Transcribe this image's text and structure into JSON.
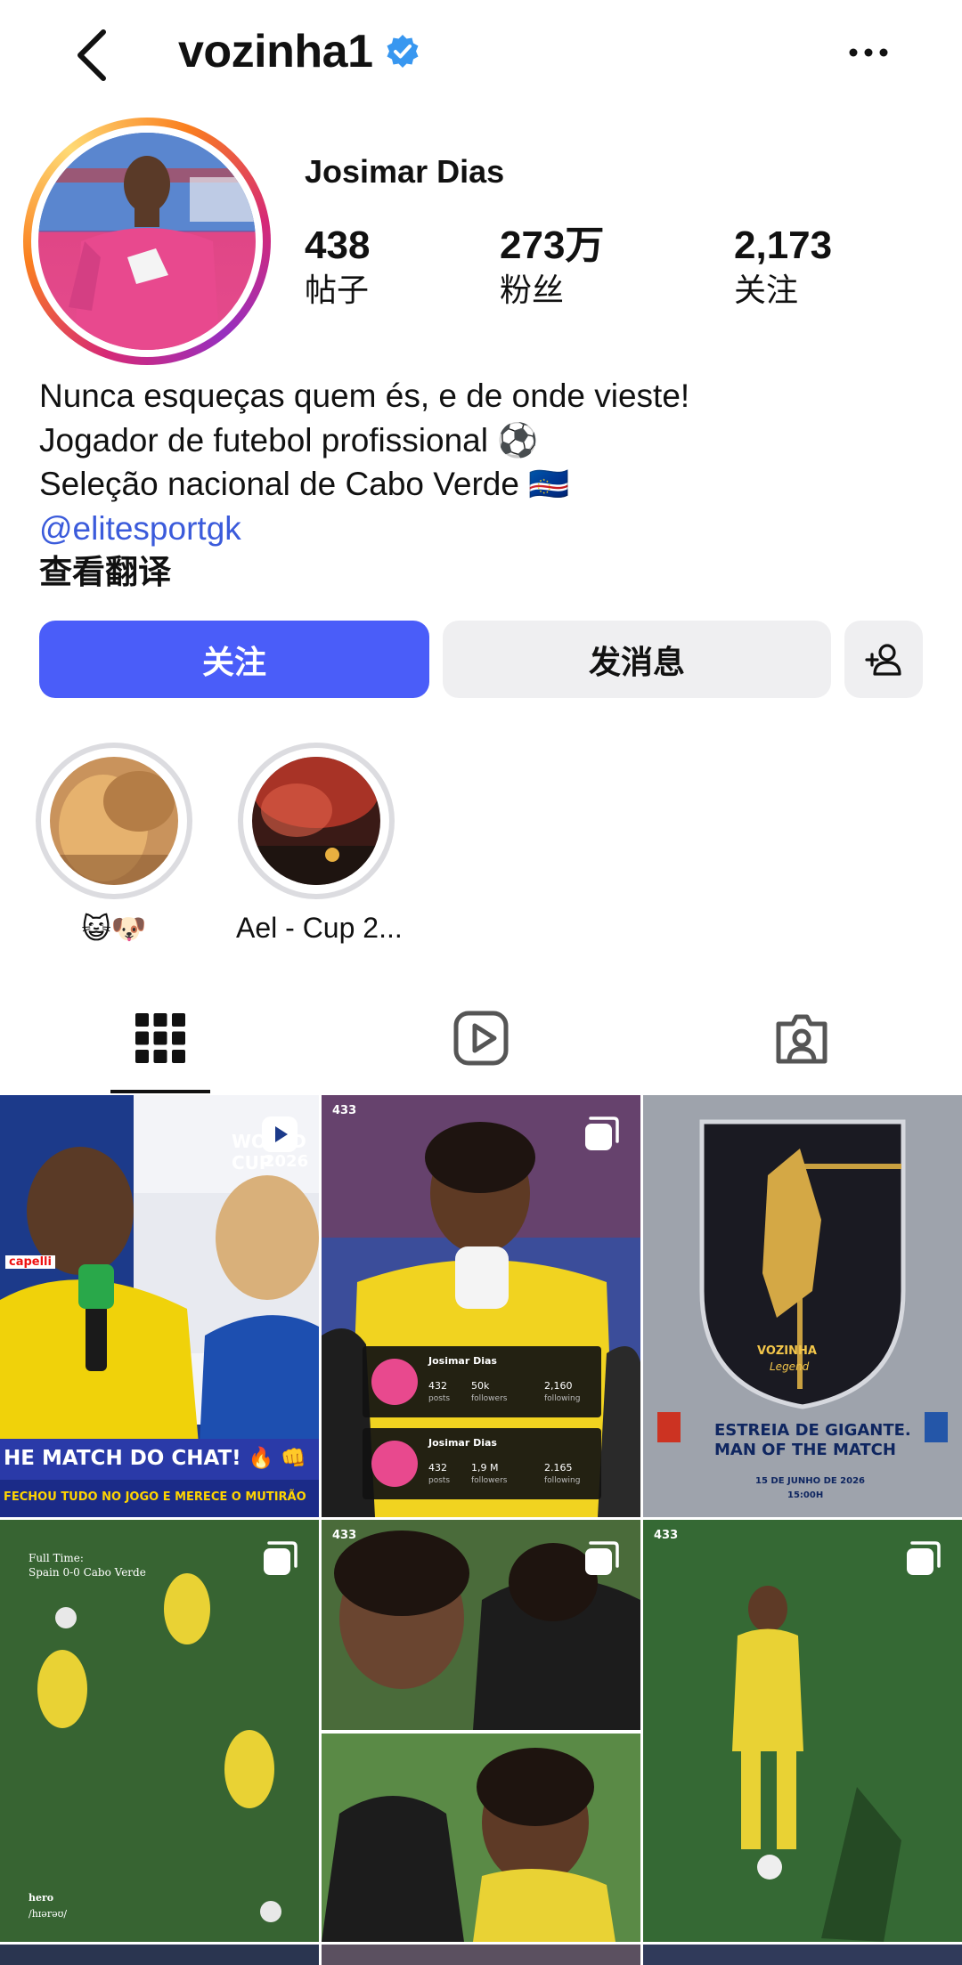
{
  "header": {
    "username": "vozinha1"
  },
  "profile": {
    "display_name": "Josimar Dias",
    "stats": [
      {
        "value": "438",
        "label": "帖子"
      },
      {
        "value": "273万",
        "label": "粉丝"
      },
      {
        "value": "2,173",
        "label": "关注"
      }
    ],
    "bio_lines": [
      "Nunca esqueças quem és, e de onde vieste!",
      "Jogador de futebol profissional ⚽",
      "Seleção nacional de Cabo Verde 🇨🇻"
    ],
    "bio_link": "@elitesportgk",
    "translate_label": "查看翻译"
  },
  "actions": {
    "follow_label": "关注",
    "message_label": "发消息"
  },
  "highlights": [
    {
      "label": "😺🐶"
    },
    {
      "label": "Ael - Cup 2..."
    }
  ],
  "posts": [
    {
      "caption_top": "WORLD CUP",
      "caption_year": "2026",
      "caption_banner": "HE MATCH DO CHAT! 🔥 👊",
      "caption_sub": "FECHOU TUDO NO JOGO E MERECE O MUTIRÃO",
      "brand": "capelli"
    },
    {
      "tag": "433",
      "card1_name": "Josimar Dias",
      "card1_posts": "432",
      "card1_followers": "50k",
      "card1_following": "2,160",
      "card2_name": "Josimar Dias",
      "card2_posts": "432",
      "card2_followers": "1,9 M",
      "card2_following": "2.165",
      "posts_word": "posts",
      "followers_word": "followers",
      "following_word": "following"
    },
    {
      "title1": "ESTREIA DE GIGANTE.",
      "title2": "MAN OF THE MATCH",
      "badge": "VOZINHA",
      "badge_sub": "Legend",
      "date": "15 DE JUNHO DE 2026",
      "time": "15:00H"
    },
    {
      "full_time": "Full Time:",
      "score": "Spain 0-0 Cabo Verde",
      "hero": "hero",
      "hero_ipa": "/hɪərəʊ/"
    },
    {
      "tag": "433"
    },
    {
      "tag": "433"
    }
  ]
}
